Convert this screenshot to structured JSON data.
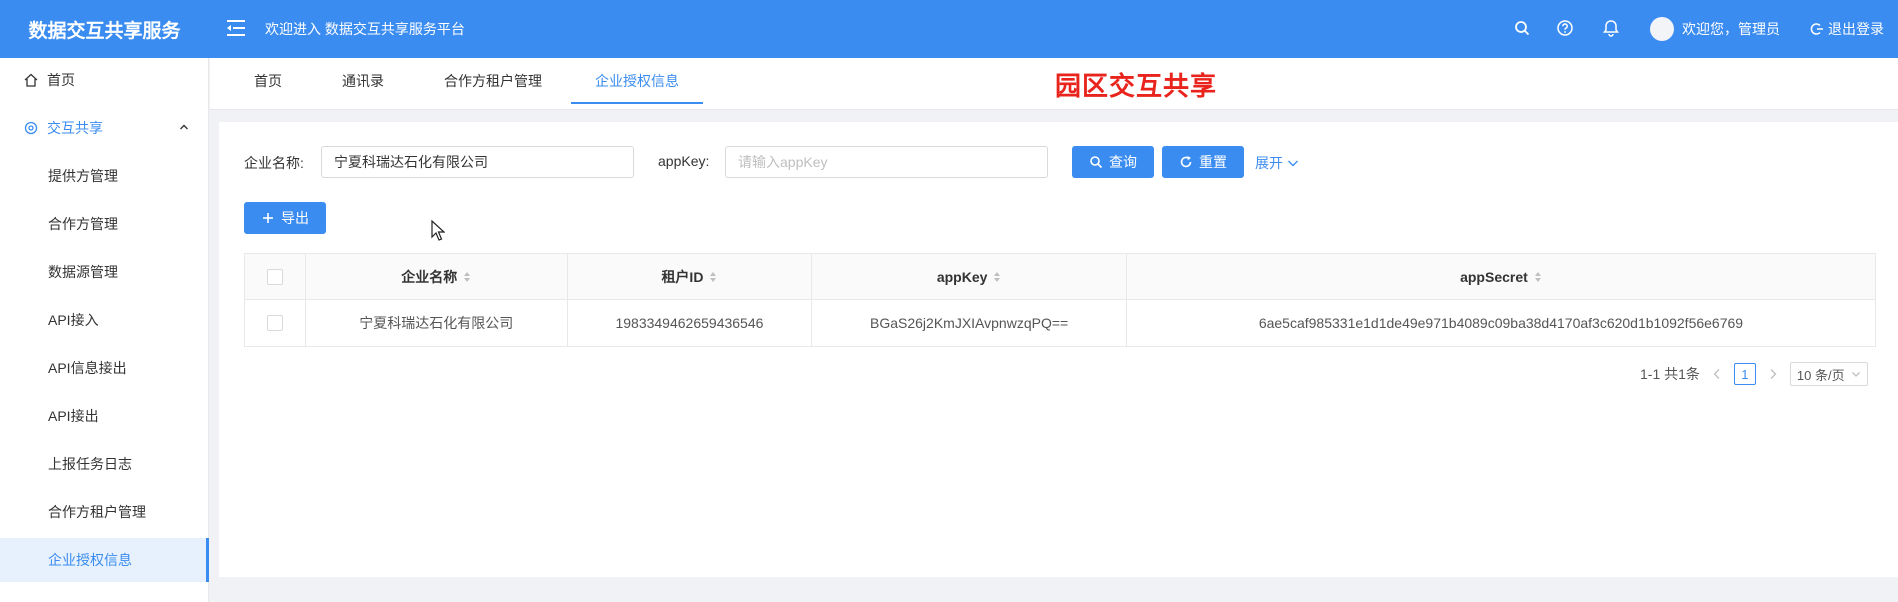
{
  "header": {
    "app_title": "数据交互共享服务",
    "welcome_platform": "欢迎进入 数据交互共享服务平台",
    "user_greeting": "欢迎您，管理员",
    "logout_label": "退出登录"
  },
  "sidebar": {
    "items": [
      {
        "label": "首页"
      },
      {
        "label": "交互共享"
      },
      {
        "label": "提供方管理"
      },
      {
        "label": "合作方管理"
      },
      {
        "label": "数据源管理"
      },
      {
        "label": "API接入"
      },
      {
        "label": "API信息接出"
      },
      {
        "label": "API接出"
      },
      {
        "label": "上报任务日志"
      },
      {
        "label": "合作方租户管理"
      },
      {
        "label": "企业授权信息"
      }
    ]
  },
  "tabs": [
    {
      "label": "首页"
    },
    {
      "label": "通讯录"
    },
    {
      "label": "合作方租户管理"
    },
    {
      "label": "企业授权信息"
    }
  ],
  "banner_title": "园区交互共享",
  "search": {
    "company_label": "企业名称:",
    "company_value": "宁夏科瑞达石化有限公司",
    "appkey_label": "appKey:",
    "appkey_placeholder": "请输入appKey",
    "query_label": "查询",
    "reset_label": "重置",
    "expand_label": "展开"
  },
  "toolbar": {
    "export_label": "导出"
  },
  "table": {
    "columns": [
      "企业名称",
      "租户ID",
      "appKey",
      "appSecret"
    ],
    "rows": [
      [
        "宁夏科瑞达石化有限公司",
        "1983349462659436546",
        "BGaS26j2KmJXIAvpnwzqPQ==",
        "6ae5caf985331e1d1de49e971b4089c09ba38d4170af3c620d1b1092f56e6769"
      ]
    ]
  },
  "pagination": {
    "summary": "1-1 共1条",
    "current_page": "1",
    "page_size": "10 条/页"
  },
  "colors": {
    "primary": "#3b8cf0",
    "banner_red": "#e8241c"
  }
}
